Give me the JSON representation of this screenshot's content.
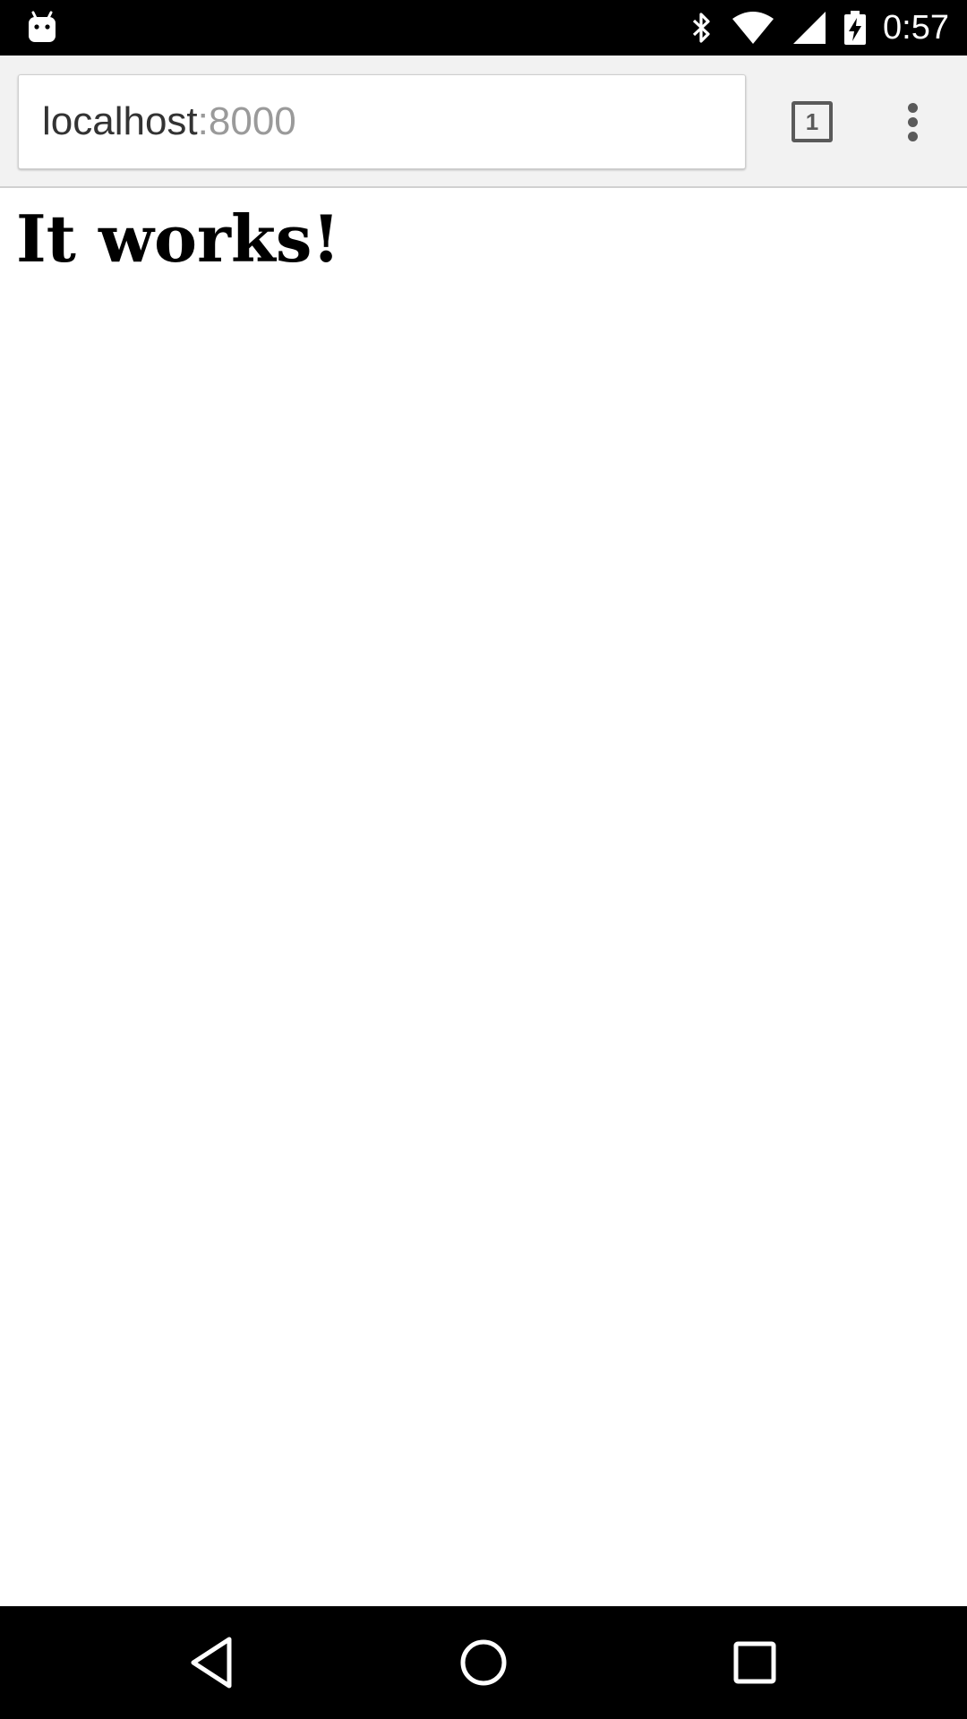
{
  "status_bar": {
    "time": "0:57",
    "icons": [
      "android-icon",
      "bluetooth-icon",
      "wifi-icon",
      "signal-icon",
      "battery-charging-icon"
    ]
  },
  "browser": {
    "url_host": "localhost",
    "url_port": ":8000",
    "tab_count": "1"
  },
  "page": {
    "heading": "It works!"
  },
  "navigation": {
    "buttons": [
      "back-icon",
      "home-icon",
      "recents-icon"
    ]
  },
  "colors": {
    "status_bar_bg": "#000000",
    "toolbar_bg": "#f2f2f2",
    "url_host_color": "#333333",
    "url_port_color": "#9a9a9a",
    "icon_color": "#5a5a5a"
  }
}
